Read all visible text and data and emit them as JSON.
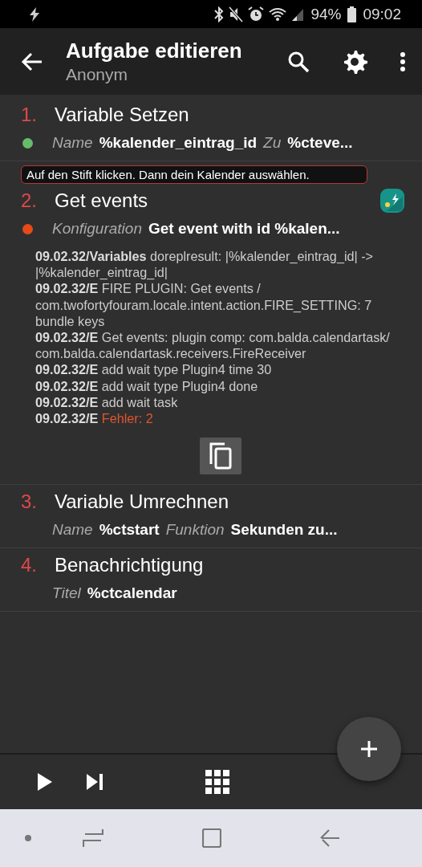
{
  "status_bar": {
    "battery": "94%",
    "time": "09:02"
  },
  "header": {
    "title": "Aufgabe editieren",
    "subtitle": "Anonym"
  },
  "actions": [
    {
      "number": "1.",
      "title": "Variable Setzen",
      "kind": "builtin",
      "color": "#66bb6a",
      "params": [
        {
          "label": "Name",
          "value": "%kalender_eintrag_id"
        },
        {
          "label": "Zu",
          "value": "%cteve..."
        }
      ]
    },
    {
      "number": "2.",
      "title": "Get events",
      "kind": "plugin",
      "color": "#e64a19",
      "comment": "Auf den Stift klicken. Dann dein Kalender auswählen.",
      "params": [
        {
          "label": "Konfiguration",
          "value": "Get event with id %kalen..."
        }
      ],
      "log": [
        {
          "time": "09.02.32/Variables",
          "text": "doreplresult: |%kalender_eintrag_id| -> |%kalender_eintrag_id|",
          "kind": "info"
        },
        {
          "time": "09.02.32/E",
          "text": "FIRE PLUGIN: Get events / com.twofortyfouram.locale.intent.action.FIRE_SETTING: 7 bundle keys",
          "kind": "info"
        },
        {
          "time": "09.02.32/E",
          "text": "Get events: plugin comp: com.balda.calendartask/ com.balda.calendartask.receivers.FireReceiver",
          "kind": "info"
        },
        {
          "time": "09.02.32/E",
          "text": "add wait type Plugin4 time 30",
          "kind": "info"
        },
        {
          "time": "09.02.32/E",
          "text": "add wait type Plugin4 done",
          "kind": "info"
        },
        {
          "time": "09.02.32/E",
          "text": "add wait task",
          "kind": "info"
        },
        {
          "time": "09.02.32/E",
          "text": "Fehler: 2",
          "kind": "error"
        }
      ]
    },
    {
      "number": "3.",
      "title": "Variable Umrechnen",
      "kind": "builtin",
      "params": [
        {
          "label": "Name",
          "value": "%ctstart"
        },
        {
          "label": "Funktion",
          "value": "Sekunden zu..."
        }
      ]
    },
    {
      "number": "4.",
      "title": "Benachrichtigung",
      "kind": "builtin",
      "params": [
        {
          "label": "Titel",
          "value": "%ctcalendar"
        }
      ]
    }
  ]
}
